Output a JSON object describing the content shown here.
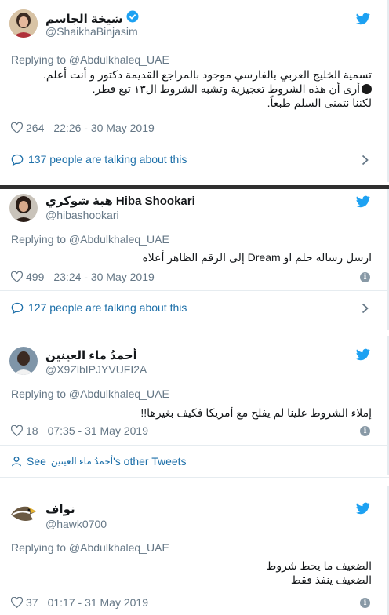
{
  "tweets": [
    {
      "display_name": "شيخة الجاسم",
      "verified": true,
      "handle": "@ShaikhaBinjasim",
      "replying": "Replying to @Abdulkhaleq_UAE",
      "lines": [
        "تسمية الخليج العربي بالفارسي موجود بالمراجع القديمة دكتور و أنت أعلم.",
        "أرى أن هذه الشروط تعجيزية وتشبه الشروط ال١٣ تبع قطر.",
        "لكننا نتمنى السلم طبعاً."
      ],
      "likes": "264",
      "timestamp": "22:26 - 30 May 2019",
      "footer": "137 people are talking about this"
    },
    {
      "display_name": "هبة شوكري Hiba Shookari",
      "handle": "@hibashookari",
      "replying": "Replying to @Abdulkhaleq_UAE",
      "lines": [
        "ارسل رساله حلم او Dream إلى الرقم الظاهر أعلاه"
      ],
      "likes": "499",
      "timestamp": "23:24 - 30 May 2019",
      "footer": "127 people are talking about this"
    },
    {
      "display_name": "أحمدُ ماء العينين",
      "handle": "@X9ZlbIPJYVUFI2A",
      "replying": "Replying to @Abdulkhaleq_UAE",
      "lines": [
        "إملاء الشروط علينا لم يفلح مع أمريكا فكيف بغيرها!!"
      ],
      "likes": "18",
      "timestamp": "07:35 - 31 May 2019",
      "footer_prefix": "See",
      "footer_name": "أحمدُ ماء العينين",
      "footer_suffix": "'s other Tweets"
    },
    {
      "display_name": "نواف",
      "handle": "@hawk0700",
      "replying": "Replying to @Abdulkhaleq_UAE",
      "lines": [
        "الضعيف ما يحط شروط",
        "الضعيف ينفذ فقط"
      ],
      "likes": "37",
      "timestamp": "01:17 - 31 May 2019"
    }
  ],
  "colors": {
    "twitter_blue": "#1da1f2",
    "link_blue": "#1b6ea8",
    "muted": "#657786",
    "heart": "#657786"
  },
  "icons": {
    "bird": "twitter-bird-icon",
    "heart": "heart-icon",
    "info": "info-icon",
    "speech": "speech-bubble-icon",
    "person": "person-icon",
    "chevron": "chevron-right-icon",
    "verified": "verified-badge-icon"
  }
}
